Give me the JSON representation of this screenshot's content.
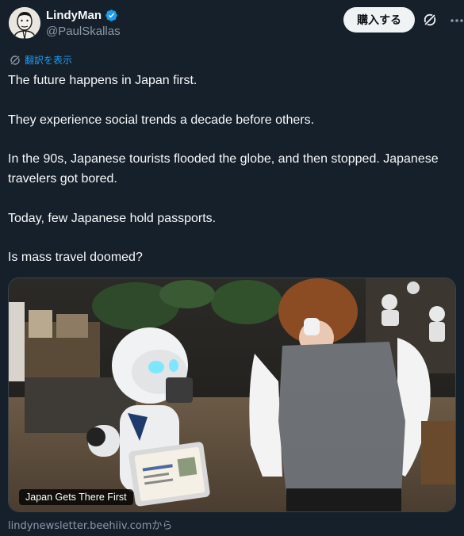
{
  "author": {
    "display_name": "LindyMan",
    "handle": "@PaulSkallas",
    "verified": true
  },
  "actions": {
    "subscribe_label": "購入する",
    "grok_icon": "grok-icon",
    "more_icon": "more-icon"
  },
  "translate": {
    "label": "翻訳を表示"
  },
  "tweet": {
    "paragraphs": [
      "The future happens in Japan first.",
      "They experience social trends a decade before others.",
      "In the 90s, Japanese tourists flooded the globe, and then stopped. Japanese travelers got bored.",
      "Today, few Japanese hold passports.",
      "Is mass travel doomed?"
    ]
  },
  "card": {
    "title": "Japan Gets There First",
    "source": "lindynewsletter.beehiiv.comから"
  },
  "colors": {
    "background": "#15202b",
    "text": "#f7f9f9",
    "muted": "#8b98a5",
    "link": "#1d9bf0",
    "verified": "#1d9bf0"
  }
}
